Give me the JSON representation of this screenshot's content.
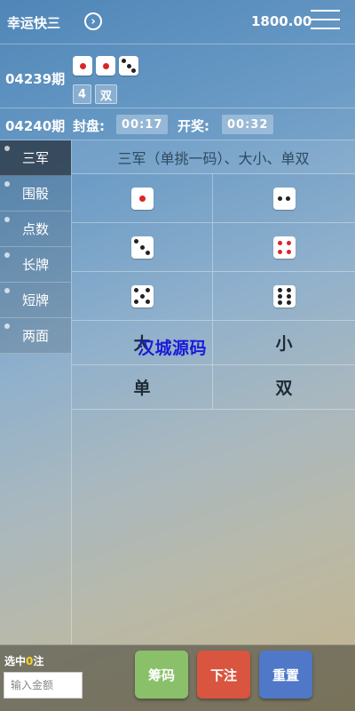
{
  "header": {
    "game_name": "幸运快三",
    "switch_icon": "›",
    "balance": "1800.00"
  },
  "last_draw": {
    "issue": "04239期",
    "dice": [
      1,
      1,
      3
    ],
    "sum": "4",
    "parity": "双"
  },
  "next_draw": {
    "issue": "04240期",
    "close_label": "封盘:",
    "close_time": "00:17",
    "open_label": "开奖:",
    "open_time": "00:32"
  },
  "sidebar": {
    "items": [
      {
        "label": "三军",
        "active": true
      },
      {
        "label": "围骰",
        "active": false
      },
      {
        "label": "点数",
        "active": false
      },
      {
        "label": "长牌",
        "active": false
      },
      {
        "label": "短牌",
        "active": false
      },
      {
        "label": "两面",
        "active": false
      }
    ]
  },
  "main": {
    "title": "三军（单挑一码）、大小、单双",
    "dice_options": [
      1,
      2,
      3,
      4,
      5,
      6
    ],
    "text_options": [
      "大",
      "小",
      "单",
      "双"
    ],
    "watermark": "汉城源码"
  },
  "footer": {
    "selected_prefix": "选中",
    "selected_count": "0",
    "selected_suffix": "注",
    "amount_placeholder": "输入金额",
    "chips_label": "筹码",
    "bet_label": "下注",
    "reset_label": "重置"
  },
  "colors": {
    "chips_button": "#8ac06a",
    "bet_button": "#d9553f",
    "reset_button": "#4f78c8",
    "die_red_pip": "#d8262b",
    "count_highlight": "#ffd21f"
  }
}
